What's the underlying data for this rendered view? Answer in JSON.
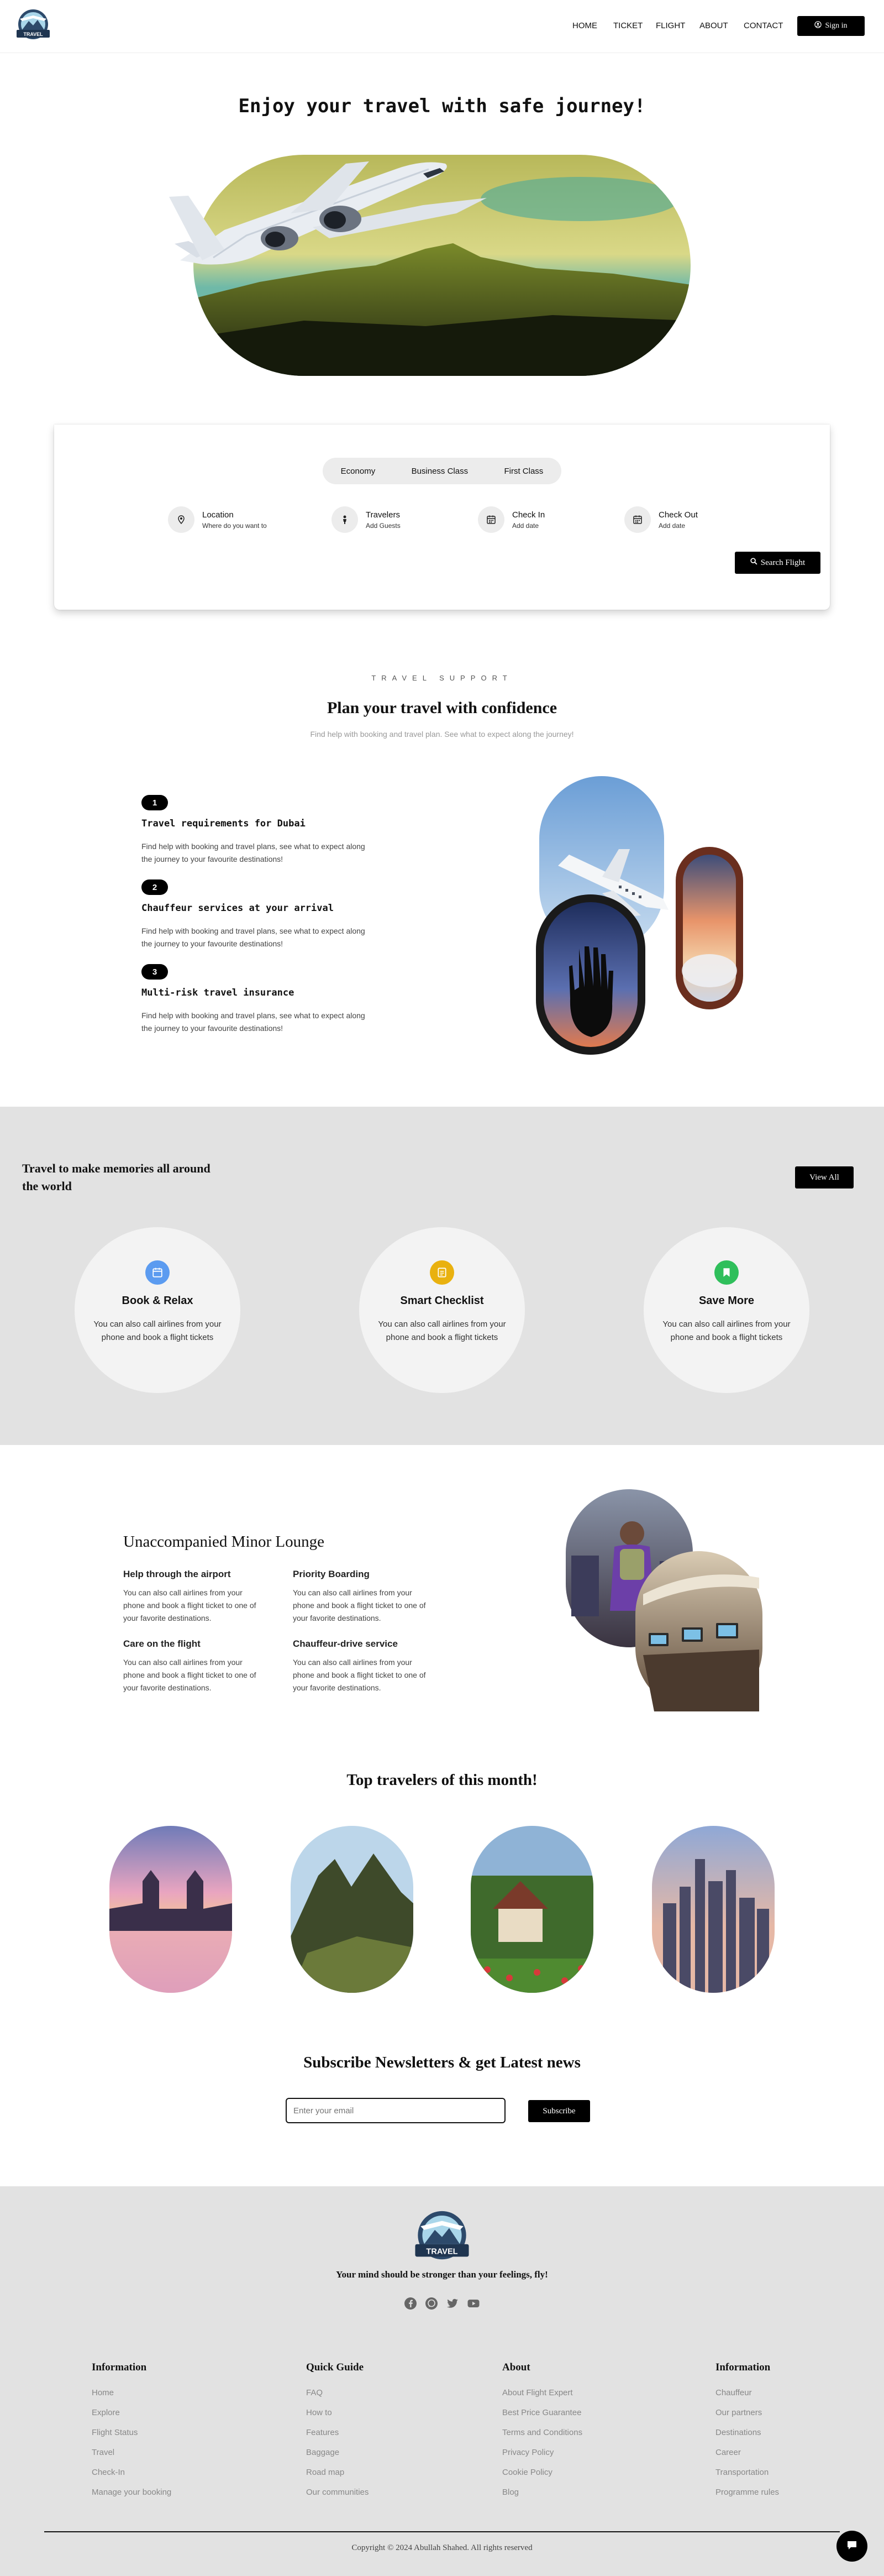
{
  "header": {
    "nav": [
      "HOME",
      "TICKET",
      "FLIGHT",
      "ABOUT",
      "CONTACT"
    ],
    "signin_label": "Sign in",
    "logo_text": "TRAVEL"
  },
  "hero": {
    "title": "Enjoy your travel with safe journey!"
  },
  "booking": {
    "tabs": [
      "Economy",
      "Business Class",
      "First Class"
    ],
    "fields": [
      {
        "label": "Location",
        "sub": "Where do you want to",
        "icon": "location-pin-icon"
      },
      {
        "label": "Travelers",
        "sub": "Add Guests",
        "icon": "person-icon"
      },
      {
        "label": "Check In",
        "sub": "Add date",
        "icon": "calendar-icon"
      },
      {
        "label": "Check Out",
        "sub": "Add date",
        "icon": "calendar-icon"
      }
    ],
    "search_label": "Search Flight"
  },
  "support": {
    "kicker": "TRAVEL SUPPORT",
    "title": "Plan your travel with confidence",
    "subtitle": "Find help with booking and travel plan. See what to expect along the journey!",
    "steps": [
      {
        "num": "1",
        "title": "Travel requirements for Dubai",
        "text": "Find help with booking and travel plans, see what to expect along the journey to your favourite destinations!"
      },
      {
        "num": "2",
        "title": "Chauffeur services at your arrival",
        "text": "Find help with booking and travel plans, see what to expect along the journey to your favourite destinations!"
      },
      {
        "num": "3",
        "title": "Multi-risk travel insurance",
        "text": "Find help with booking and travel plans, see what to expect along the journey to your favourite destinations!"
      }
    ]
  },
  "memories": {
    "title": "Travel to make memories all around the world",
    "view_all": "View All",
    "cards": [
      {
        "title": "Book & Relax",
        "text": "You can also call airlines from your phone and book a flight tickets",
        "icon": "calendar-icon",
        "color": "#5b9bf0"
      },
      {
        "title": "Smart Checklist",
        "text": "You can also call airlines from your phone and book a flight tickets",
        "icon": "checklist-icon",
        "color": "#e9b10f"
      },
      {
        "title": "Save More",
        "text": "You can also call airlines from your phone and book a flight tickets",
        "icon": "bookmark-icon",
        "color": "#2fbf5b"
      }
    ]
  },
  "lounge": {
    "title": "Unaccompanied Minor Lounge",
    "items": [
      {
        "title": "Help through the airport",
        "text": "You can also call airlines from your phone and book a flight ticket to one of your favorite destinations."
      },
      {
        "title": "Priority Boarding",
        "text": "You can also call airlines from your phone and book a flight ticket to one of your favorite destinations."
      },
      {
        "title": "Care on the flight",
        "text": "You can also call airlines from your phone and book a flight ticket to one of your favorite destinations."
      },
      {
        "title": "Chauffeur-drive service",
        "text": "You can also call airlines from your phone and book a flight ticket to one of your favorite destinations."
      }
    ]
  },
  "travelers": {
    "title": "Top travelers of this month!"
  },
  "subscribe": {
    "title": "Subscribe Newsletters & get Latest news",
    "placeholder": "Enter your email",
    "button": "Subscribe"
  },
  "footer": {
    "tagline": "Your mind should be stronger than your feelings, fly!",
    "social_icons": [
      "facebook-icon",
      "whatsapp-icon",
      "twitter-icon",
      "youtube-icon"
    ],
    "columns": [
      {
        "title": "Information",
        "items": [
          "Home",
          "Explore",
          "Flight Status",
          "Travel",
          "Check-In",
          "Manage your booking"
        ]
      },
      {
        "title": "Quick Guide",
        "items": [
          "FAQ",
          "How to",
          "Features",
          "Baggage",
          "Road map",
          "Our communities"
        ]
      },
      {
        "title": "About",
        "items": [
          "About Flight Expert",
          "Best Price Guarantee",
          "Terms and Conditions",
          "Privacy Policy",
          "Cookie Policy",
          "Blog"
        ]
      },
      {
        "title": "Information",
        "items": [
          "Chauffeur",
          "Our partners",
          "Destinations",
          "Career",
          "Transportation",
          "Programme rules"
        ]
      }
    ],
    "copyright": "Copyright © 2024 Abullah Shahed. All rights reserved"
  }
}
